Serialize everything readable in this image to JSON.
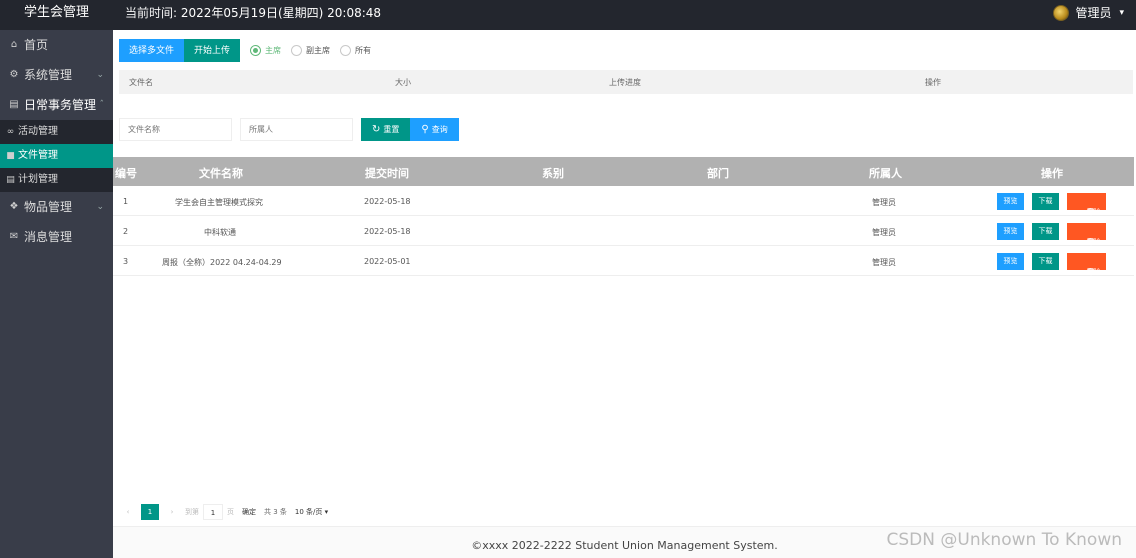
{
  "app": {
    "logo": "学生会管理"
  },
  "header": {
    "time_label": "当前时间:",
    "time_value": "2022年05月19日(星期四) 20:08:48",
    "user": "管理员"
  },
  "sidebar": {
    "items": [
      {
        "label": "首页",
        "icon": "home-icon"
      },
      {
        "label": "系统管理",
        "icon": "gear-icon"
      },
      {
        "label": "日常事务管理",
        "icon": "document-icon"
      },
      {
        "label": "物品管理",
        "icon": "box-icon"
      },
      {
        "label": "消息管理",
        "icon": "mail-icon"
      }
    ],
    "sub_items": [
      {
        "label": "活动管理",
        "icon": "link-icon"
      },
      {
        "label": "文件管理",
        "icon": "folder-icon"
      },
      {
        "label": "计划管理",
        "icon": "list-icon"
      }
    ]
  },
  "upload": {
    "choose_label": "选择多文件",
    "start_label": "开始上传",
    "radios": [
      "主席",
      "副主席",
      "所有"
    ],
    "selected": "主席",
    "headers": [
      "文件名",
      "大小",
      "上传进度",
      "操作"
    ]
  },
  "search": {
    "file_placeholder": "文件名称",
    "owner_placeholder": "所属人",
    "reset_label": "重置",
    "query_label": "查询"
  },
  "table": {
    "headers": [
      "编号",
      "文件名称",
      "提交时间",
      "系别",
      "部门",
      "所属人",
      "操作"
    ],
    "rows": [
      {
        "no": "1",
        "name": "学生会自主管理模式探究",
        "date": "2022-05-18",
        "dept": "",
        "section": "",
        "owner": "管理员"
      },
      {
        "no": "2",
        "name": "中科软通",
        "date": "2022-05-18",
        "dept": "",
        "section": "",
        "owner": "管理员"
      },
      {
        "no": "3",
        "name": "周报（全称）2022 04.24-04.29",
        "date": "2022-05-01",
        "dept": "",
        "section": "",
        "owner": "管理员"
      }
    ],
    "actions": {
      "preview": "预览",
      "download": "下载",
      "delete": "删除"
    }
  },
  "pager": {
    "current": "1",
    "goto_label": "到第",
    "page_input": "1",
    "page_unit": "页",
    "confirm": "确定",
    "total": "共 3 条",
    "per_page": "10 条/页"
  },
  "footer": {
    "text": "©xxxx 2022-2222 Student Union Management System."
  },
  "watermark": "CSDN @Unknown To Known",
  "colors": {
    "primary_green": "#009688",
    "blue": "#1e9fff",
    "red": "#ff5722",
    "sidebar": "#393d49",
    "header": "#23262e"
  }
}
